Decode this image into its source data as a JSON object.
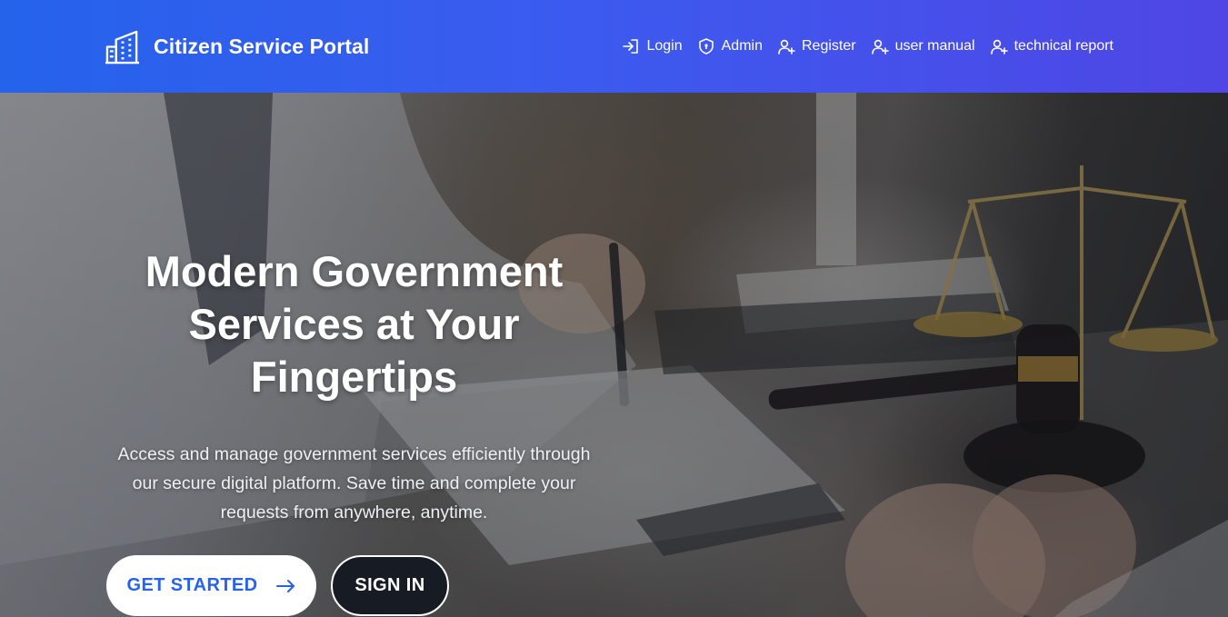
{
  "brand": {
    "title": "Citizen Service Portal",
    "icon": "building-icon"
  },
  "nav": [
    {
      "label": "Login",
      "icon": "login-icon"
    },
    {
      "label": "Admin",
      "icon": "shield-icon"
    },
    {
      "label": "Register",
      "icon": "user-plus-icon"
    },
    {
      "label": "user manual",
      "icon": "user-plus-icon"
    },
    {
      "label": "technical report",
      "icon": "user-plus-icon"
    }
  ],
  "hero": {
    "title": "Modern Government Services at Your Fingertips",
    "subtitle": "Access and manage government services efficiently through our secure digital platform. Save time and complete your requests from anywhere, anytime.",
    "cta_primary": "GET STARTED",
    "cta_secondary": "SIGN IN"
  },
  "colors": {
    "nav_gradient_start": "#2563eb",
    "nav_gradient_end": "#4f46e5",
    "primary_text": "#2563eb"
  }
}
